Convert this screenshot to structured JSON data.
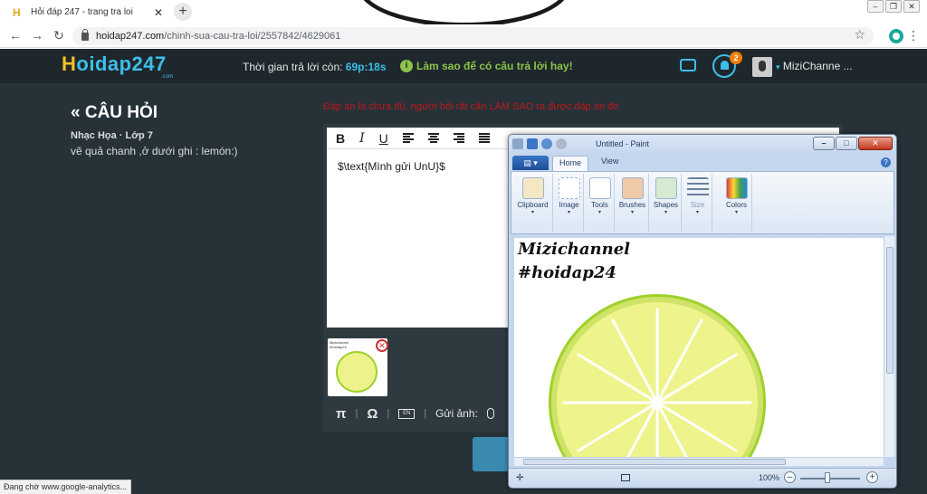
{
  "browser": {
    "tab_title": "Hỏi đáp 247 - trang tra loi",
    "tab_favicon": "H",
    "url_host": "hoidap247.com",
    "url_path": "/chinh-sua-cau-tra-loi/2557842/4629061",
    "status": "Đang chờ www.google-analytics..."
  },
  "site": {
    "logo_h": "H",
    "logo_rest": "oidap247",
    "logo_sub": ".com",
    "timer_label": "Thời gian trả lời còn:",
    "timer_value": "69p:18s",
    "tip": "Làm sao để có câu trả lời hay!",
    "notification_count": "2",
    "user_name": "MiziChanne ..."
  },
  "question": {
    "heading": "CÂU HỎI",
    "meta": "Nhạc Họa · Lớp 7",
    "body": "vẽ quả chanh ,ở dưới ghi : lemón:)"
  },
  "answer": {
    "warning": "Đáp án là chưa đủ, người hỏi rất cần LÀM SAO ra được đáp án đó",
    "content": "$\\text{Mình gửi UnU}$",
    "bottom_upload_label": "Gửi ảnh:",
    "en_label": "EN"
  },
  "paint": {
    "title": "Untitled - Paint",
    "file_tab": "",
    "tabs": [
      "Home",
      "View"
    ],
    "groups": [
      "Clipboard",
      "Image",
      "Tools",
      "Brushes",
      "Shapes",
      "Size",
      "Colors"
    ],
    "canvas_line1": "Mizichannel",
    "canvas_line2": "#hoidap24",
    "zoom": "100%"
  },
  "colors": {
    "accent": "#3dbeea",
    "tip_green": "#8bc34a",
    "warning_red": "#c0151b",
    "lemon_fill": "#eef38b",
    "lemon_rind": "#9ed22b"
  }
}
